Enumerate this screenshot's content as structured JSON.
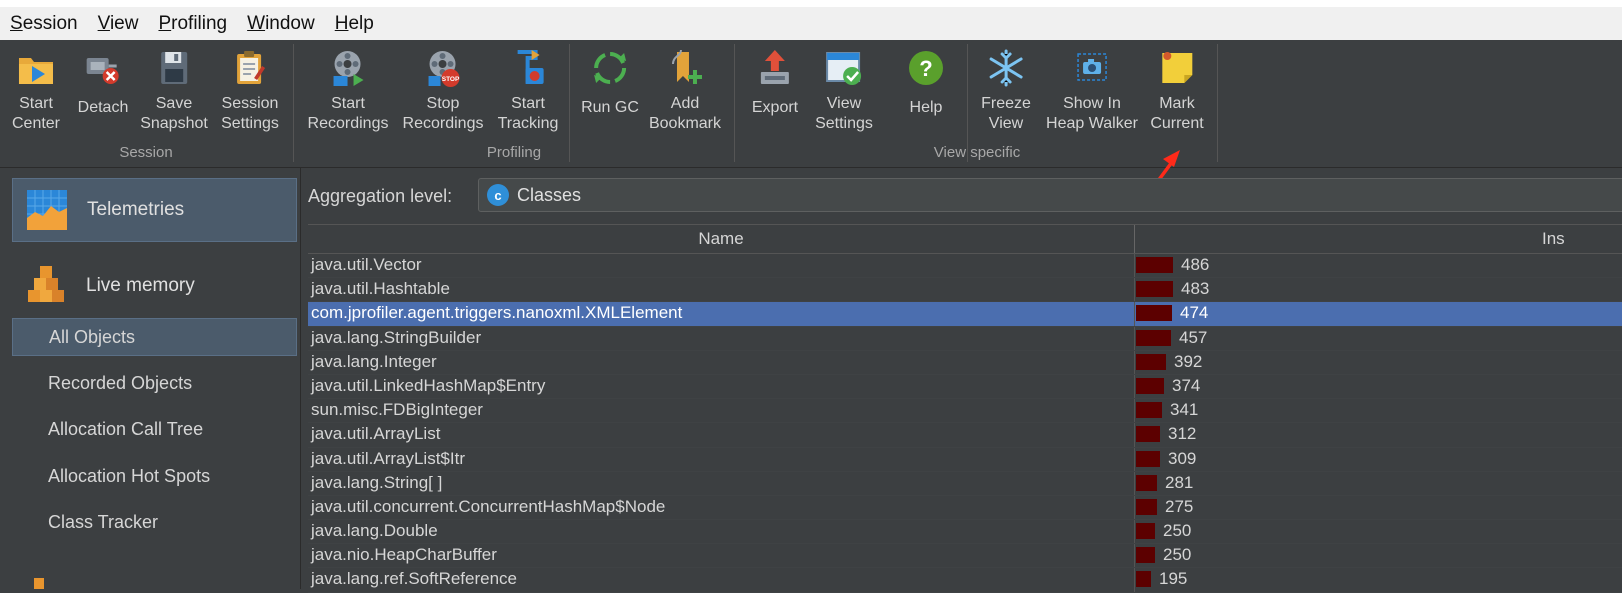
{
  "menu": {
    "items": [
      {
        "mnemonic": "S",
        "rest": "ession"
      },
      {
        "mnemonic": "V",
        "rest": "iew"
      },
      {
        "mnemonic": "P",
        "rest": "rofiling"
      },
      {
        "mnemonic": "W",
        "rest": "indow"
      },
      {
        "mnemonic": "H",
        "rest": "elp"
      }
    ]
  },
  "toolbar": {
    "start_center": {
      "line1": "Start",
      "line2": "Center"
    },
    "detach": "Detach",
    "save_snapshot": {
      "line1": "Save",
      "line2": "Snapshot"
    },
    "session_settings": {
      "line1": "Session",
      "line2": "Settings"
    },
    "start_recordings": {
      "line1": "Start",
      "line2": "Recordings"
    },
    "stop_recordings": {
      "line1": "Stop",
      "line2": "Recordings"
    },
    "start_tracking": {
      "line1": "Start",
      "line2": "Tracking"
    },
    "run_gc": "Run GC",
    "add_bookmark": {
      "line1": "Add",
      "line2": "Bookmark"
    },
    "export": "Export",
    "view_settings": {
      "line1": "View",
      "line2": "Settings"
    },
    "help": "Help",
    "freeze_view": {
      "line1": "Freeze",
      "line2": "View"
    },
    "show_in_heap_walker": {
      "line1": "Show In",
      "line2": "Heap Walker"
    },
    "mark_current": {
      "line1": "Mark",
      "line2": "Current"
    },
    "groups": {
      "session": "Session",
      "profiling": "Profiling",
      "view_specific": "View specific"
    },
    "stop_badge": "STOP"
  },
  "sidebar": {
    "telemetries": "Telemetries",
    "live_memory": "Live memory",
    "items": [
      "All Objects",
      "Recorded Objects",
      "Allocation Call Tree",
      "Allocation Hot Spots",
      "Class Tracker"
    ]
  },
  "main": {
    "aggregation_label": "Aggregation level:",
    "aggregation_badge": "c",
    "aggregation_value": "Classes",
    "columns": {
      "name": "Name",
      "instances": "Ins"
    },
    "max_value": 486,
    "rows": [
      {
        "name": "java.util.Vector",
        "value": 486
      },
      {
        "name": "java.util.Hashtable",
        "value": 483
      },
      {
        "name": "com.jprofiler.agent.triggers.nanoxml.XMLElement",
        "value": 474,
        "selected": true
      },
      {
        "name": "java.lang.StringBuilder",
        "value": 457
      },
      {
        "name": "java.lang.Integer",
        "value": 392
      },
      {
        "name": "java.util.LinkedHashMap$Entry",
        "value": 374
      },
      {
        "name": "sun.misc.FDBigInteger",
        "value": 341
      },
      {
        "name": "java.util.ArrayList",
        "value": 312
      },
      {
        "name": "java.util.ArrayList$Itr",
        "value": 309
      },
      {
        "name": "java.lang.String[ ]",
        "value": 281
      },
      {
        "name": "java.util.concurrent.ConcurrentHashMap$Node",
        "value": 275
      },
      {
        "name": "java.lang.Double",
        "value": 250
      },
      {
        "name": "java.nio.HeapCharBuffer",
        "value": 250
      },
      {
        "name": "java.lang.ref.SoftReference",
        "value": 195
      }
    ]
  },
  "colors": {
    "bar": "#5c0000",
    "selection": "#4b6eaf",
    "annotation_arrow": "#ff2a1a"
  }
}
